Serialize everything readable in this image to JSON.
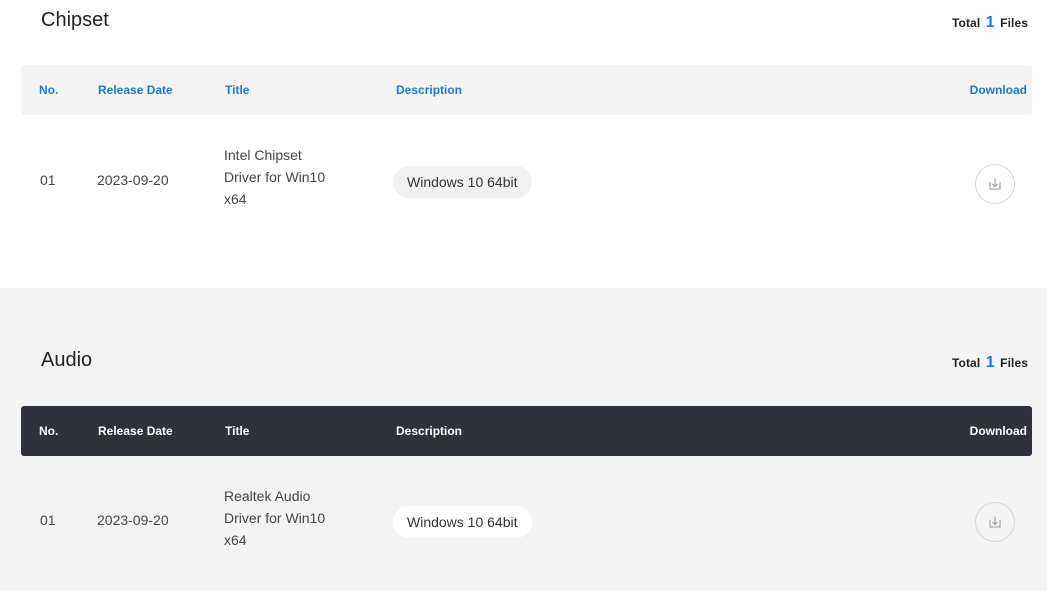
{
  "sections": [
    {
      "title": "Chipset",
      "total_prefix": "Total",
      "total_count": "1",
      "total_suffix": "Files",
      "columns": {
        "no": "No.",
        "release_date": "Release Date",
        "title": "Title",
        "description": "Description",
        "download": "Download"
      },
      "rows": [
        {
          "no": "01",
          "release_date": "2023-09-20",
          "title_lines": [
            "Intel Chipset",
            "Driver for Win10",
            "x64"
          ],
          "description": "Windows 10 64bit",
          "download_icon": "download-icon"
        }
      ]
    },
    {
      "title": "Audio",
      "total_prefix": "Total",
      "total_count": "1",
      "total_suffix": "Files",
      "columns": {
        "no": "No.",
        "release_date": "Release Date",
        "title": "Title",
        "description": "Description",
        "download": "Download"
      },
      "rows": [
        {
          "no": "01",
          "release_date": "2023-09-20",
          "title_lines": [
            "Realtek Audio",
            "Driver for Win10",
            "x64"
          ],
          "description": "Windows 10 64bit",
          "download_icon": "download-icon"
        }
      ]
    }
  ],
  "colors": {
    "accent": "#1a7ad9",
    "dark_header": "#2f323a",
    "light_header": "#f4f4f4",
    "section_bg": "#f4f4f4"
  }
}
